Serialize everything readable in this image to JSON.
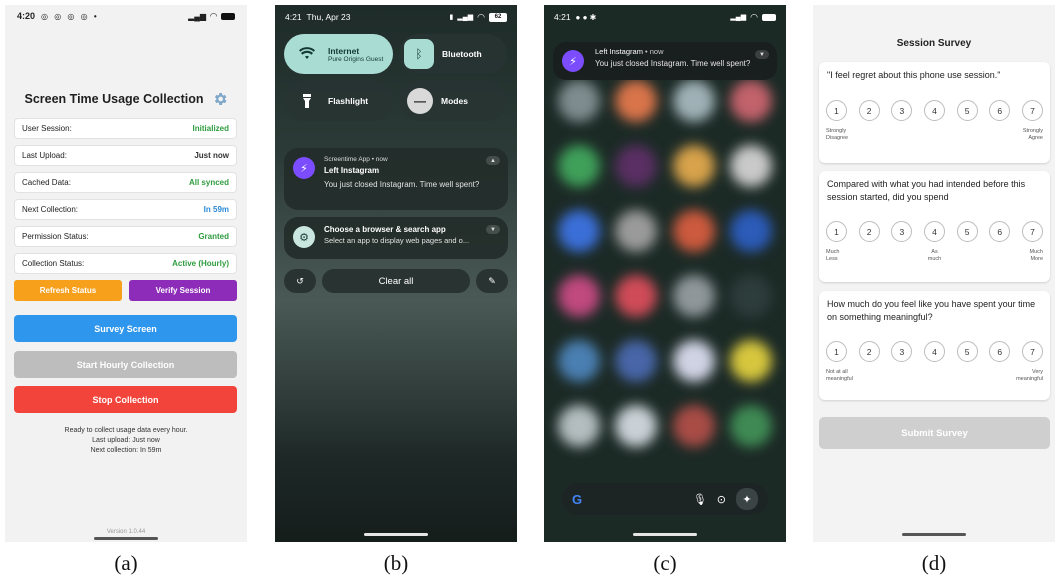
{
  "captions": [
    "(a)",
    "(b)",
    "(c)",
    "(d)"
  ],
  "screenA": {
    "status_time": "4:20",
    "status_dots": "◎ ◎ ◎ ◎ •",
    "title": "Screen Time Usage Collection",
    "rows": [
      {
        "label": "User Session:",
        "value": "Initialized",
        "color": "#2e9c3f"
      },
      {
        "label": "Last Upload:",
        "value": "Just now",
        "color": "#333333"
      },
      {
        "label": "Cached Data:",
        "value": "All synced",
        "color": "#2e9c3f"
      },
      {
        "label": "Next Collection:",
        "value": "In 59m",
        "color": "#2a8ad6"
      },
      {
        "label": "Permission Status:",
        "value": "Granted",
        "color": "#2e9c3f"
      },
      {
        "label": "Collection Status:",
        "value": "Active (Hourly)",
        "color": "#2e9c3f"
      }
    ],
    "refresh_label": "Refresh Status",
    "verify_label": "Verify Session",
    "survey_label": "Survey Screen",
    "start_label": "Start Hourly Collection",
    "stop_label": "Stop Collection",
    "info_lines": [
      "Ready to collect usage data every hour.",
      "Last upload: Just now",
      "Next collection: In 59m"
    ],
    "version": "Version 1.0.44",
    "colors": {
      "refresh": "#f7a01c",
      "verify": "#8d2cb8",
      "survey": "#2f96ee",
      "start": "#bdbdbd",
      "stop": "#f2443a",
      "gear": "#7fa7c9"
    }
  },
  "screenB": {
    "status_time": "4:21",
    "status_date": "Thu, Apr 23",
    "battery": "62",
    "tiles": [
      {
        "title": "Internet",
        "subtitle": "Pure Origins Guest",
        "icon": "wifi-icon"
      },
      {
        "title": "Bluetooth",
        "subtitle": "",
        "icon": "bluetooth-icon"
      },
      {
        "title": "Flashlight",
        "subtitle": "",
        "icon": "flashlight-icon"
      },
      {
        "title": "Modes",
        "subtitle": "",
        "icon": "modes-icon"
      }
    ],
    "notif1": {
      "app": "Screentime App • now",
      "title": "Left Instagram",
      "body": "You just closed Instagram. Time well spent?"
    },
    "notif2": {
      "title": "Choose a browser & search app",
      "body": "Select an app to display web pages and o..."
    },
    "clear_label": "Clear all"
  },
  "screenC": {
    "status_time": "4:21",
    "notif": {
      "app": "Left Instagram",
      "meta": "• now",
      "body": "You just closed Instagram. Time well spent?"
    },
    "google_letter": "G"
  },
  "screenD": {
    "title": "Session Survey",
    "questions": [
      {
        "text": "\"I feel regret about this phone use session.\"",
        "anchors": [
          "Strongly Disagree",
          "",
          "Strongly Agree"
        ]
      },
      {
        "text": "Compared with what you had intended before this session started, did you spend",
        "anchors": [
          "Much Less",
          "As much",
          "Much More"
        ]
      },
      {
        "text": "How much do you feel like you have spent your time on something meaningful?",
        "anchors": [
          "Not at all meaningful",
          "",
          "Very meaningful"
        ]
      }
    ],
    "scale": [
      "1",
      "2",
      "3",
      "4",
      "5",
      "6",
      "7"
    ],
    "submit_label": "Submit Survey"
  }
}
